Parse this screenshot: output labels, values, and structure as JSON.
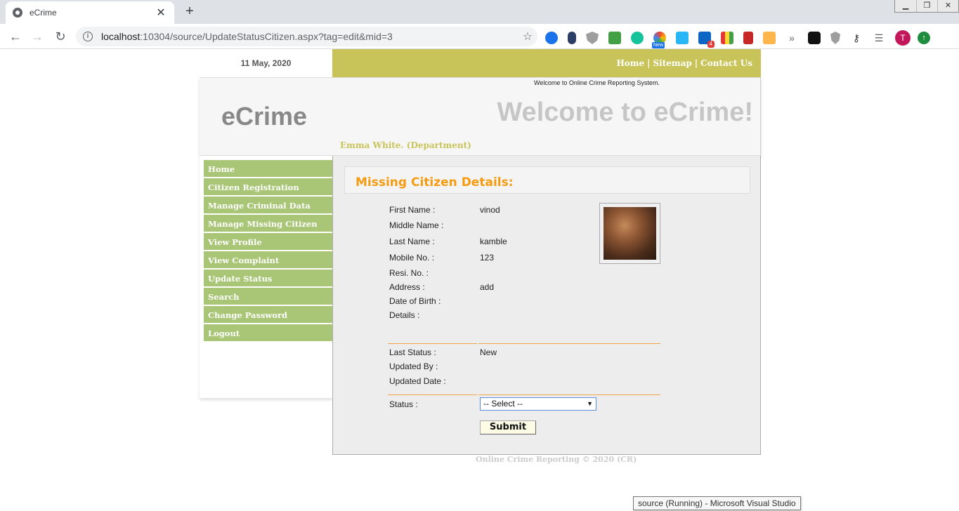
{
  "browser": {
    "tab_title": "eCrime",
    "url_host": "localhost",
    "url_rest": ":10304/source/UpdateStatusCitizen.aspx?tag=edit&mid=3",
    "profile_initial": "T",
    "ext_badge": "4",
    "ext_new_label": "New"
  },
  "page": {
    "date": "11 May, 2020",
    "topnav": [
      "Home",
      "Sitemap",
      "Contact Us"
    ],
    "tagline": "Welcome to Online Crime Reporting System.",
    "logo": "eCrime",
    "welcome": "Welcome to eCrime!",
    "user": "Emma White. (Department)",
    "sidebar": [
      "Home",
      "Citizen Registration",
      "Manage Criminal Data",
      "Manage Missing Citizen",
      "View Profile",
      "View Complaint",
      "Update Status",
      "Search",
      "Change Password",
      "Logout"
    ],
    "section_title": "Missing Citizen Details:",
    "fields": [
      {
        "label": "First Name :",
        "value": "vinod"
      },
      {
        "label": "Middle Name :",
        "value": ""
      },
      {
        "label": "Last Name :",
        "value": "kamble"
      },
      {
        "label": "Mobile No. :",
        "value": "123"
      },
      {
        "label": "Resi. No. :",
        "value": ""
      },
      {
        "label": "Address :",
        "value": "add"
      },
      {
        "label": "Date of Birth :",
        "value": ""
      },
      {
        "label": "Details :",
        "value": ""
      }
    ],
    "status_fields": [
      {
        "label": "Last Status :",
        "value": "New"
      },
      {
        "label": "Updated By :",
        "value": ""
      },
      {
        "label": "Updated Date :",
        "value": ""
      }
    ],
    "status_label": "Status :",
    "status_select": "-- Select --",
    "submit_label": "Submit",
    "footer": "Online Crime Reporting © 2020 (CR)",
    "taskbar_tooltip": "source (Running) - Microsoft Visual Studio"
  }
}
